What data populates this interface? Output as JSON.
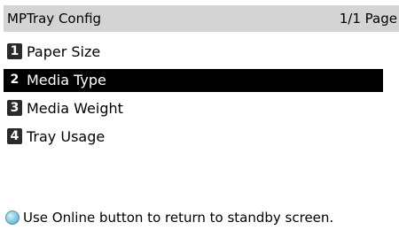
{
  "header": {
    "title": "MPTray Config",
    "page_indicator": "1/1 Page"
  },
  "menu": {
    "items": [
      {
        "number": "1",
        "label": "Paper Size",
        "selected": false
      },
      {
        "number": "2",
        "label": "Media Type",
        "selected": true
      },
      {
        "number": "3",
        "label": "Media Weight",
        "selected": false
      },
      {
        "number": "4",
        "label": "Tray Usage",
        "selected": false
      }
    ]
  },
  "footer": {
    "icon": "online-button-icon",
    "message": "Use Online button to return to standby screen."
  },
  "colors": {
    "header_bg": "#d4d4d4",
    "selected_bg": "#000000",
    "selected_fg": "#ffffff",
    "badge_bg": "#2b2b2b",
    "online_icon": "#8fcfe6"
  }
}
